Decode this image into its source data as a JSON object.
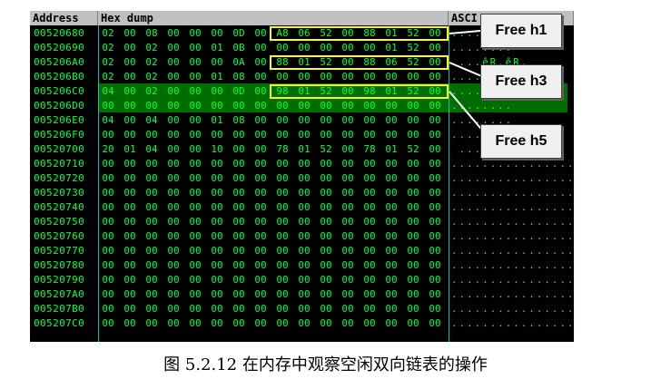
{
  "headers": {
    "address": "Address",
    "hex": "Hex dump",
    "ascii": "ASCI"
  },
  "rows": [
    {
      "addr": "00520680",
      "bytes": [
        "02",
        "00",
        "08",
        "00",
        "00",
        "00",
        "0D",
        "00",
        "A8",
        "06",
        "52",
        "00",
        "88",
        "01",
        "52",
        "00"
      ],
      "ascii": "........"
    },
    {
      "addr": "00520690",
      "bytes": [
        "02",
        "00",
        "02",
        "00",
        "00",
        "01",
        "0B",
        "00",
        "00",
        "00",
        "00",
        "00",
        "00",
        "01",
        "52",
        "00"
      ],
      "ascii": "........"
    },
    {
      "addr": "005206A0",
      "bytes": [
        "02",
        "00",
        "02",
        "00",
        "00",
        "00",
        "0A",
        "00",
        "88",
        "01",
        "52",
        "00",
        "88",
        "06",
        "52",
        "00"
      ],
      "ascii": "....êR.êR."
    },
    {
      "addr": "005206B0",
      "bytes": [
        "02",
        "00",
        "02",
        "00",
        "00",
        "01",
        "08",
        "00",
        "00",
        "00",
        "00",
        "00",
        "00",
        "00",
        "00",
        "00"
      ],
      "ascii": "........"
    },
    {
      "addr": "005206C0",
      "bytes": [
        "04",
        "00",
        "02",
        "00",
        "00",
        "00",
        "0D",
        "00",
        "98",
        "01",
        "52",
        "00",
        "98",
        "01",
        "52",
        "00"
      ],
      "ascii": "........"
    },
    {
      "addr": "005206D0",
      "bytes": [
        "00",
        "00",
        "00",
        "00",
        "00",
        "00",
        "00",
        "00",
        "00",
        "00",
        "00",
        "00",
        "00",
        "00",
        "00",
        "00"
      ],
      "ascii": "........"
    },
    {
      "addr": "005206E0",
      "bytes": [
        "04",
        "00",
        "04",
        "00",
        "00",
        "01",
        "08",
        "00",
        "00",
        "00",
        "00",
        "00",
        "00",
        "00",
        "00",
        "00"
      ],
      "ascii": "........"
    },
    {
      "addr": "005206F0",
      "bytes": [
        "00",
        "00",
        "00",
        "00",
        "00",
        "00",
        "00",
        "00",
        "00",
        "00",
        "00",
        "00",
        "00",
        "00",
        "00",
        "00"
      ],
      "ascii": "........"
    },
    {
      "addr": "00520700",
      "bytes": [
        "20",
        "01",
        "04",
        "00",
        "00",
        "10",
        "00",
        "00",
        "78",
        "01",
        "52",
        "00",
        "78",
        "01",
        "52",
        "00"
      ],
      "ascii": " ......"
    },
    {
      "addr": "00520710",
      "bytes": [
        "00",
        "00",
        "00",
        "00",
        "00",
        "00",
        "00",
        "00",
        "00",
        "00",
        "00",
        "00",
        "00",
        "00",
        "00",
        "00"
      ],
      "ascii": "................"
    },
    {
      "addr": "00520720",
      "bytes": [
        "00",
        "00",
        "00",
        "00",
        "00",
        "00",
        "00",
        "00",
        "00",
        "00",
        "00",
        "00",
        "00",
        "00",
        "00",
        "00"
      ],
      "ascii": "................"
    },
    {
      "addr": "00520730",
      "bytes": [
        "00",
        "00",
        "00",
        "00",
        "00",
        "00",
        "00",
        "00",
        "00",
        "00",
        "00",
        "00",
        "00",
        "00",
        "00",
        "00"
      ],
      "ascii": "................"
    },
    {
      "addr": "00520740",
      "bytes": [
        "00",
        "00",
        "00",
        "00",
        "00",
        "00",
        "00",
        "00",
        "00",
        "00",
        "00",
        "00",
        "00",
        "00",
        "00",
        "00"
      ],
      "ascii": "................"
    },
    {
      "addr": "00520750",
      "bytes": [
        "00",
        "00",
        "00",
        "00",
        "00",
        "00",
        "00",
        "00",
        "00",
        "00",
        "00",
        "00",
        "00",
        "00",
        "00",
        "00"
      ],
      "ascii": "................"
    },
    {
      "addr": "00520760",
      "bytes": [
        "00",
        "00",
        "00",
        "00",
        "00",
        "00",
        "00",
        "00",
        "00",
        "00",
        "00",
        "00",
        "00",
        "00",
        "00",
        "00"
      ],
      "ascii": "................"
    },
    {
      "addr": "00520770",
      "bytes": [
        "00",
        "00",
        "00",
        "00",
        "00",
        "00",
        "00",
        "00",
        "00",
        "00",
        "00",
        "00",
        "00",
        "00",
        "00",
        "00"
      ],
      "ascii": "................"
    },
    {
      "addr": "00520780",
      "bytes": [
        "00",
        "00",
        "00",
        "00",
        "00",
        "00",
        "00",
        "00",
        "00",
        "00",
        "00",
        "00",
        "00",
        "00",
        "00",
        "00"
      ],
      "ascii": "................"
    },
    {
      "addr": "00520790",
      "bytes": [
        "00",
        "00",
        "00",
        "00",
        "00",
        "00",
        "00",
        "00",
        "00",
        "00",
        "00",
        "00",
        "00",
        "00",
        "00",
        "00"
      ],
      "ascii": "................"
    },
    {
      "addr": "005207A0",
      "bytes": [
        "00",
        "00",
        "00",
        "00",
        "00",
        "00",
        "00",
        "00",
        "00",
        "00",
        "00",
        "00",
        "00",
        "00",
        "00",
        "00"
      ],
      "ascii": "................"
    },
    {
      "addr": "005207B0",
      "bytes": [
        "00",
        "00",
        "00",
        "00",
        "00",
        "00",
        "00",
        "00",
        "00",
        "00",
        "00",
        "00",
        "00",
        "00",
        "00",
        "00"
      ],
      "ascii": "................"
    },
    {
      "addr": "005207C0",
      "bytes": [
        "00",
        "00",
        "00",
        "00",
        "00",
        "00",
        "00",
        "00",
        "00",
        "00",
        "00",
        "00",
        "00",
        "00",
        "00",
        "00"
      ],
      "ascii": "................"
    }
  ],
  "callouts": [
    {
      "label": "Free h1"
    },
    {
      "label": "Free h3"
    },
    {
      "label": "Free h5"
    }
  ],
  "caption": "图 5.2.12    在内存中观察空闲双向链表的操作",
  "colors": {
    "text_green": "#00ff40",
    "highlight_green": "#008000",
    "box_yellow": "#ffff00",
    "header_gray": "#c0c0c0"
  }
}
